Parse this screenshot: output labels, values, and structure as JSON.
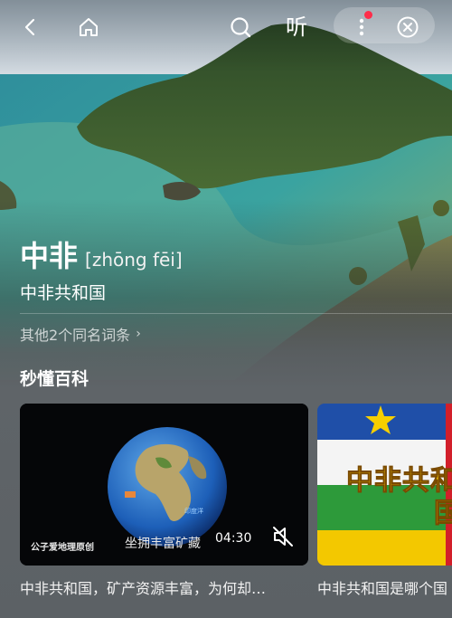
{
  "topbar": {
    "back_icon": "chevron-left-icon",
    "home_icon": "home-icon",
    "search_icon": "search-icon",
    "listen_label": "听",
    "more_icon": "more-vertical-icon",
    "close_icon": "close-circle-icon",
    "notification_color": "#ff2d4a"
  },
  "entry": {
    "title": "中非",
    "pinyin": "[zhōng fēi]",
    "subtitle": "中非共和国",
    "homonyms": "其他2个同名词条",
    "homonyms_chevron": "›"
  },
  "section": {
    "title": "秒懂百科"
  },
  "videos": [
    {
      "title": "中非共和国，矿产资源丰富，为何却…",
      "caption": "坐拥丰富矿藏",
      "watermark": "公子爱地理原创",
      "duration": "04:30",
      "mute_icon": "mute-icon"
    },
    {
      "title": "中非共和国是哪个国",
      "overlay_line1": "中非共和",
      "overlay_line2": "国"
    }
  ]
}
